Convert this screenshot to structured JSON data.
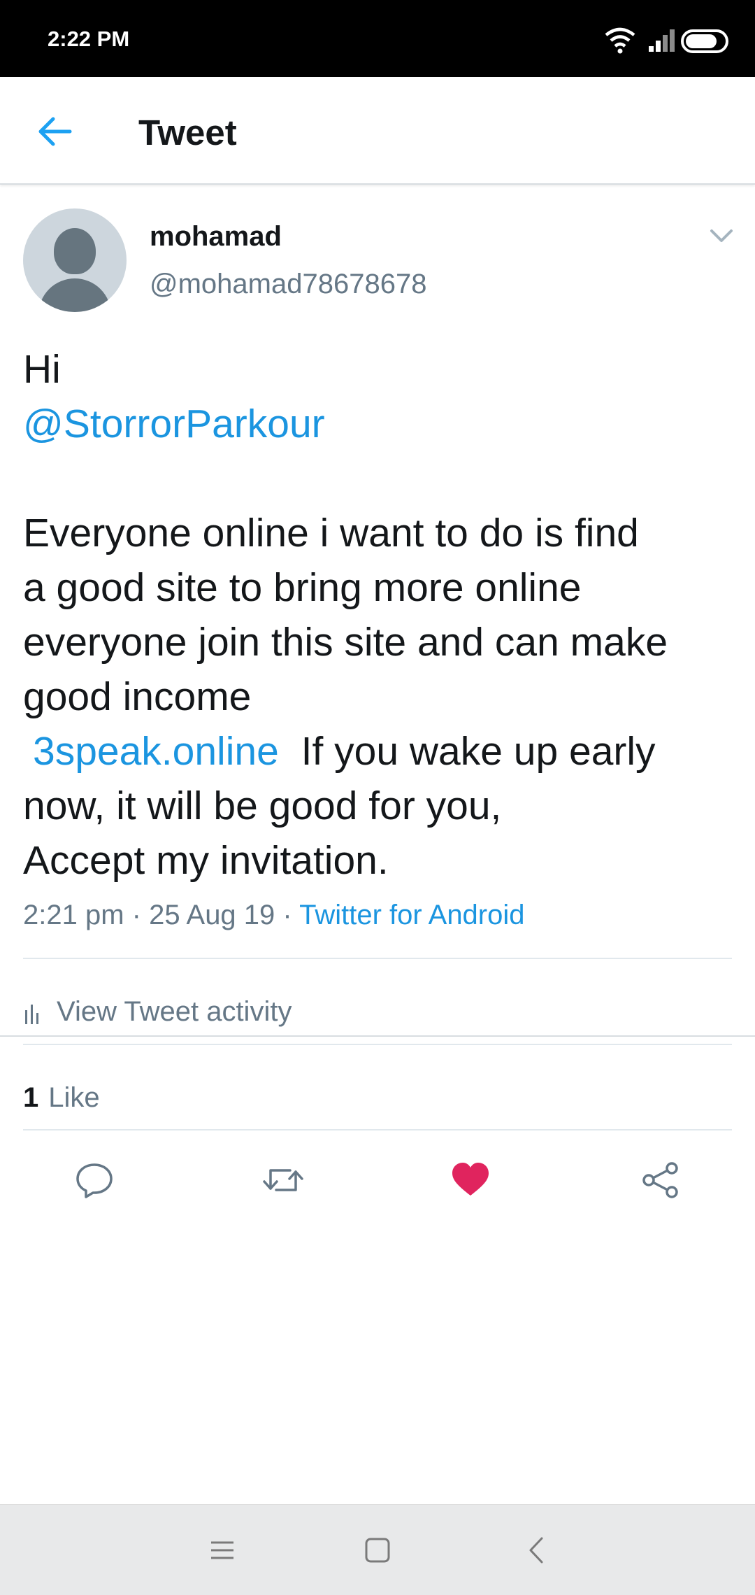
{
  "status_bar": {
    "time": "2:22 PM",
    "icons": [
      "wifi-icon",
      "signal-icon",
      "battery-icon"
    ]
  },
  "header": {
    "title": "Tweet",
    "back_icon": "arrow-left-icon"
  },
  "tweet": {
    "author": {
      "name": "mohamad",
      "handle": "@mohamad78678678"
    },
    "text_lines": [
      "Hi",
      "@StorrorParkour",
      "",
      "Everyone online i want to do is find",
      "a good site to bring more online",
      "everyone join this site and can make",
      "good income",
      "3speak.online",
      " If you wake up early",
      "now, it will be good for you,",
      "Accept my invitation."
    ],
    "meta": {
      "time": "2:21 pm",
      "separator": "·",
      "date": "25 Aug 19",
      "source": "Twitter for Android"
    },
    "activity_label": "View Tweet activity",
    "likes_count": "1",
    "likes_label": "Like",
    "actions": [
      "reply-icon",
      "retweet-icon",
      "like-icon",
      "share-icon"
    ],
    "liked": true
  },
  "colors": {
    "accent": "#1b95e0",
    "like": "#e0245e",
    "secondary_text": "#657786",
    "primary_text": "#14171a"
  },
  "nav_bar": {
    "buttons": [
      "menu-icon",
      "home-icon",
      "back-icon"
    ]
  }
}
